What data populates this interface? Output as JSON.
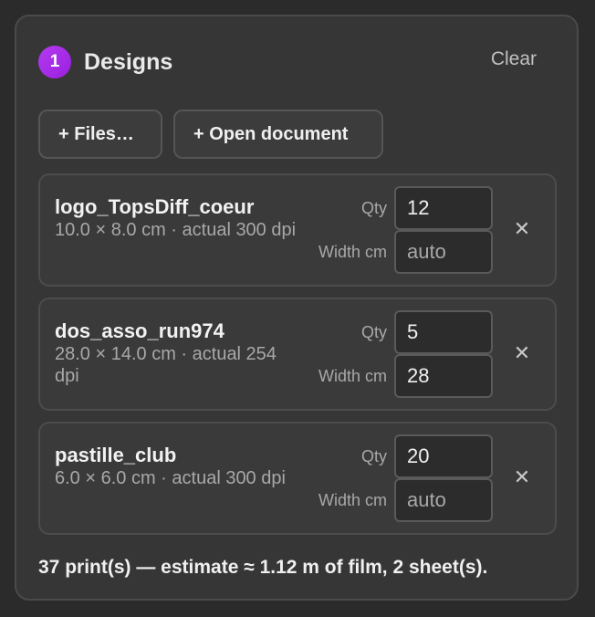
{
  "header": {
    "step": "1",
    "title": "Designs",
    "clear_label": "Clear"
  },
  "actions": {
    "files_label": "+ Files…",
    "open_document_label": "+ Open document"
  },
  "designs": [
    {
      "name": "logo_TopsDiff_coeur",
      "meta": "10.0 × 8.0 cm · actual 300 dpi",
      "qty_label": "Qty",
      "qty_value": "12",
      "width_label": "Width cm",
      "width_value": "",
      "width_placeholder": "auto",
      "remove_label": "✕"
    },
    {
      "name": "dos_asso_run974",
      "meta": "28.0 × 14.0 cm · actual 254 dpi",
      "qty_label": "Qty",
      "qty_value": "5",
      "width_label": "Width cm",
      "width_value": "28",
      "width_placeholder": "auto",
      "remove_label": "✕"
    },
    {
      "name": "pastille_club",
      "meta": "6.0 × 6.0 cm · actual 300 dpi",
      "qty_label": "Qty",
      "qty_value": "20",
      "width_label": "Width cm",
      "width_value": "",
      "width_placeholder": "auto",
      "remove_label": "✕"
    }
  ],
  "summary": "37 print(s) — estimate ≈ 1.12 m of film, 2 sheet(s).",
  "colors": {
    "accent": "#a52ee8",
    "background": "#2b2b2b",
    "panel": "#363636"
  }
}
